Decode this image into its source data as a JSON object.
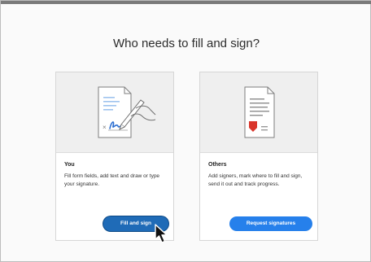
{
  "dialog": {
    "title": "Who needs to fill and sign?"
  },
  "cards": [
    {
      "heading": "You",
      "description": "Fill form fields, add text and draw or type your signature.",
      "button_label": "Fill and sign",
      "icon": "document-signature-pen-icon"
    },
    {
      "heading": "Others",
      "description": "Add signers, mark where to fill and sign, send it out and track progress.",
      "button_label": "Request signatures",
      "icon": "document-signature-marker-icon"
    }
  ],
  "colors": {
    "primary_button": "#2680eb",
    "primary_button_hover": "#1f6bb7",
    "accent_red": "#d9352b",
    "signature_blue": "#2d6fd1"
  },
  "cursor": "arrow-pointer-icon"
}
